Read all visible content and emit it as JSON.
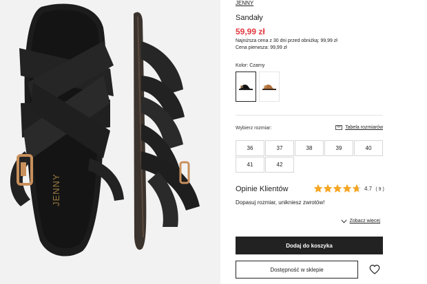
{
  "product": {
    "brand": "JENNY",
    "name": "Sandały",
    "price": "59,99 zł",
    "lowest_price_note": "Najniższa cena z 30 dni przed obniżką: 99,99 zł",
    "first_price_note": "Cena pierwsza: 99,99 zł",
    "insole_logo": "JENNY",
    "accent_color": "#e2383f"
  },
  "color": {
    "label": "Kolor: Czarny",
    "swatches": [
      {
        "name": "Czarny",
        "selected": true
      },
      {
        "name": "Brązowy",
        "selected": false
      }
    ]
  },
  "sizes": {
    "label": "Wybierz rozmiar:",
    "table_link": "Tabela rozmiarów",
    "values": [
      "36",
      "37",
      "38",
      "39",
      "40",
      "41",
      "42"
    ]
  },
  "reviews": {
    "title": "Opinie Klientów",
    "rating": "4.7",
    "count": "( 9 )",
    "stars": 4.7,
    "fit_text": "Dopasuj rozmiar, unikniesz zwrotów!",
    "see_more": "Zobacz więcej"
  },
  "actions": {
    "add_to_cart": "Dodaj do koszyka",
    "store_availability": "Dostępność w sklepie"
  }
}
